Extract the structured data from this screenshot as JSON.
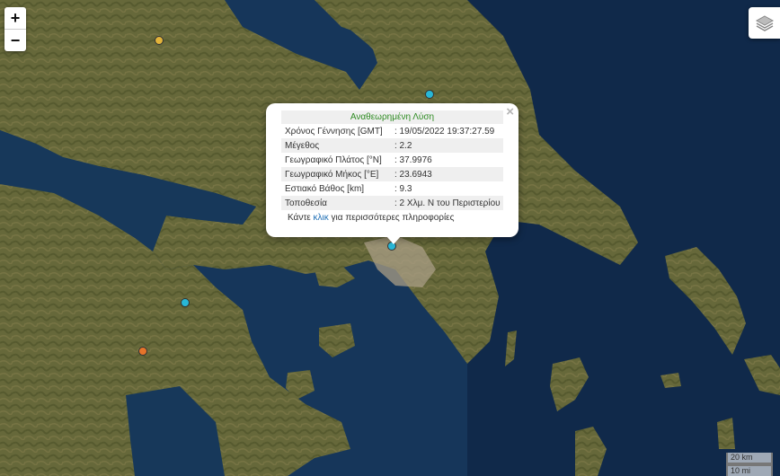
{
  "map": {
    "colors": {
      "sea_deep": "#0f2a44",
      "sea": "#17385a",
      "land": "#6a6b3a",
      "land_dark": "#4d5129",
      "land_light": "#8c8452",
      "urban": "#b9ae9b"
    },
    "markers": [
      {
        "name": "earthquake-marker-yellow",
        "color": "#e2b33a"
      },
      {
        "name": "earthquake-marker-cyan-north",
        "color": "#28b7d6"
      },
      {
        "name": "earthquake-marker-selected",
        "color": "#28b7d6"
      },
      {
        "name": "earthquake-marker-cyan-west",
        "color": "#28b7d6"
      },
      {
        "name": "earthquake-marker-orange",
        "color": "#e6742a"
      }
    ]
  },
  "controls": {
    "zoom_in": "+",
    "zoom_out": "−",
    "layers_icon": "layers-icon"
  },
  "popup": {
    "title": "Αναθεωρημένη Λύση",
    "close": "×",
    "rows": [
      {
        "label": "Χρόνος Γέννησης [GMT]",
        "value": ": 19/05/2022 19:37:27.59"
      },
      {
        "label": "Μέγεθος",
        "value": ": 2.2"
      },
      {
        "label": "Γεωγραφικό Πλάτος [°N]",
        "value": ": 37.9976"
      },
      {
        "label": "Γεωγραφικό Μήκος [°E]",
        "value": ": 23.6943"
      },
      {
        "label": "Εστιακό Βάθος [km]",
        "value": ": 9.3"
      },
      {
        "label": "Τοποθεσία",
        "value": ": 2 Χλμ. Ν του Περιστερίου"
      }
    ],
    "more_prefix": "Κάντε",
    "more_link": "κλικ",
    "more_suffix": "για περισσότερες πληροφορίες"
  },
  "scale": {
    "km": "20 km",
    "mi": "10 mi"
  }
}
